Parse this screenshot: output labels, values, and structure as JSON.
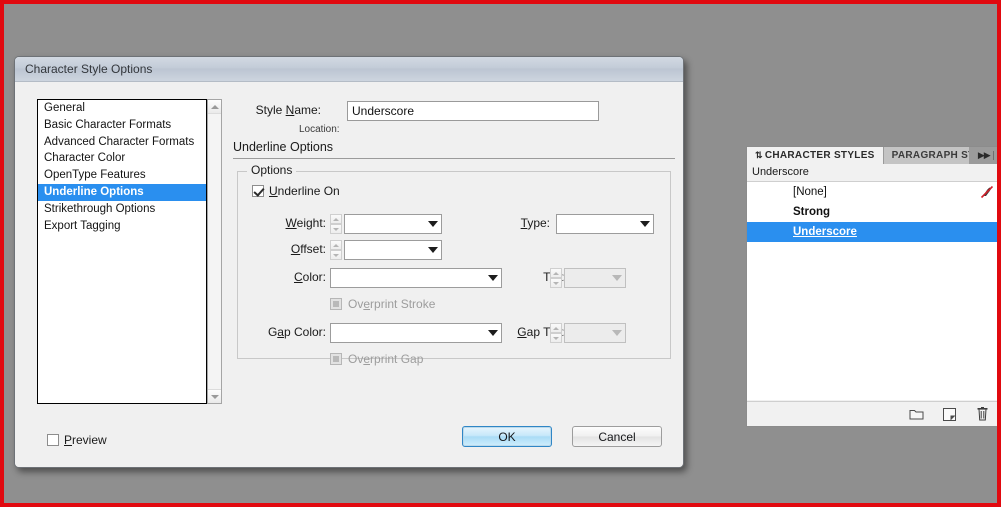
{
  "window": {
    "title": "Character Style Options"
  },
  "categories": [
    {
      "label": "General",
      "selected": false
    },
    {
      "label": "Basic Character Formats",
      "selected": false
    },
    {
      "label": "Advanced Character Formats",
      "selected": false
    },
    {
      "label": "Character Color",
      "selected": false
    },
    {
      "label": "OpenType Features",
      "selected": false
    },
    {
      "label": "Underline Options",
      "selected": true
    },
    {
      "label": "Strikethrough Options",
      "selected": false
    },
    {
      "label": "Export Tagging",
      "selected": false
    }
  ],
  "form": {
    "style_name_label": "Style Name:",
    "style_name_value": "Underscore",
    "location_label": "Location:",
    "location_value": "",
    "section_header": "Underline Options",
    "group_legend": "Options",
    "underline_on_label": "Underline On",
    "underline_on_checked": true,
    "fields": {
      "weight_label": "Weight:",
      "weight_value": "",
      "offset_label": "Offset:",
      "offset_value": "",
      "type_label": "Type:",
      "type_value": "",
      "color_label": "Color:",
      "color_value": "",
      "tint_label": "Tint:",
      "tint_value": "",
      "overprint_stroke_label": "Overprint Stroke",
      "overprint_stroke_checked": false,
      "gap_color_label": "Gap Color:",
      "gap_color_value": "",
      "gap_tint_label": "Gap Tint:",
      "gap_tint_value": "",
      "overprint_gap_label": "Overprint Gap",
      "overprint_gap_checked": false
    }
  },
  "footer": {
    "preview_label": "Preview",
    "preview_checked": false,
    "ok_label": "OK",
    "cancel_label": "Cancel"
  },
  "character_styles_panel": {
    "tab_active": "CHARACTER STYLES",
    "tab_inactive": "PARAGRAPH STY",
    "current_style": "Underscore",
    "rows": [
      {
        "name": "[None]",
        "selected": false,
        "bold": false,
        "has_none_icon": true
      },
      {
        "name": "Strong",
        "selected": false,
        "bold": true,
        "has_none_icon": false
      },
      {
        "name": "Underscore",
        "selected": true,
        "bold": true,
        "has_none_icon": false
      }
    ],
    "footer_icons": [
      "new-style-group-icon",
      "create-new-style-icon",
      "delete-style-icon"
    ]
  },
  "colors": {
    "selection_blue": "#2a8fef",
    "desktop_gray": "#8f8f8f",
    "frame_red": "#e1090f",
    "dialog_bg": "#f0f0f0"
  }
}
